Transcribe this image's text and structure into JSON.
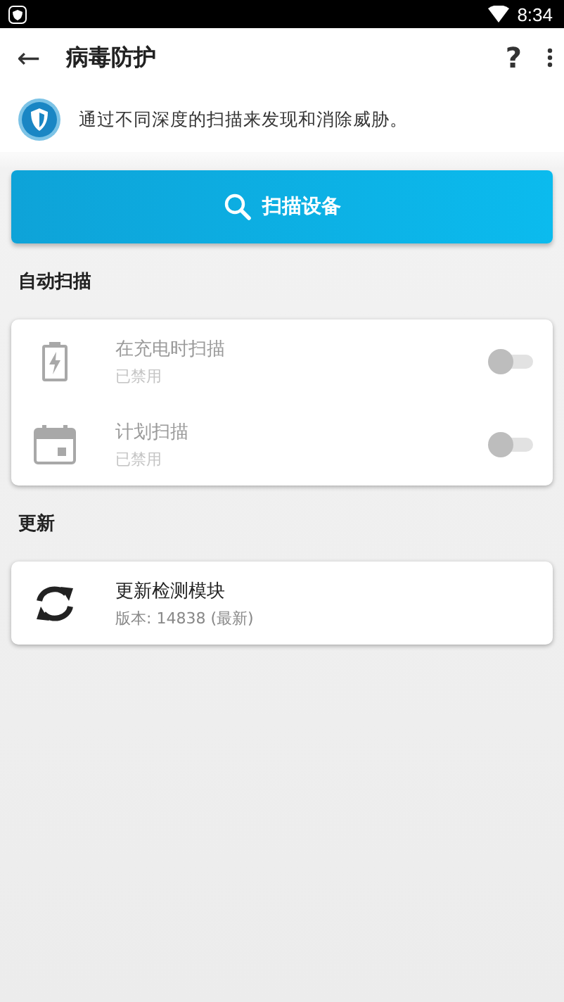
{
  "status_bar": {
    "time": "8:34"
  },
  "app_bar": {
    "back": "←",
    "title": "病毒防护",
    "help": "?"
  },
  "intro": {
    "text": "通过不同深度的扫描来发现和消除威胁。"
  },
  "scan_button": {
    "label": "扫描设备"
  },
  "sections": [
    {
      "title": "自动扫描",
      "items": [
        {
          "kind": "battery",
          "title": "在充电时扫描",
          "subtitle": "已禁用",
          "disabled": true,
          "on": false
        },
        {
          "kind": "calendar",
          "title": "计划扫描",
          "subtitle": "已禁用",
          "disabled": true,
          "on": false
        }
      ]
    },
    {
      "title": "更新",
      "items": [
        {
          "kind": "refresh",
          "title": "更新检测模块",
          "subtitle": "版本: 14838 (最新)"
        }
      ]
    }
  ]
}
